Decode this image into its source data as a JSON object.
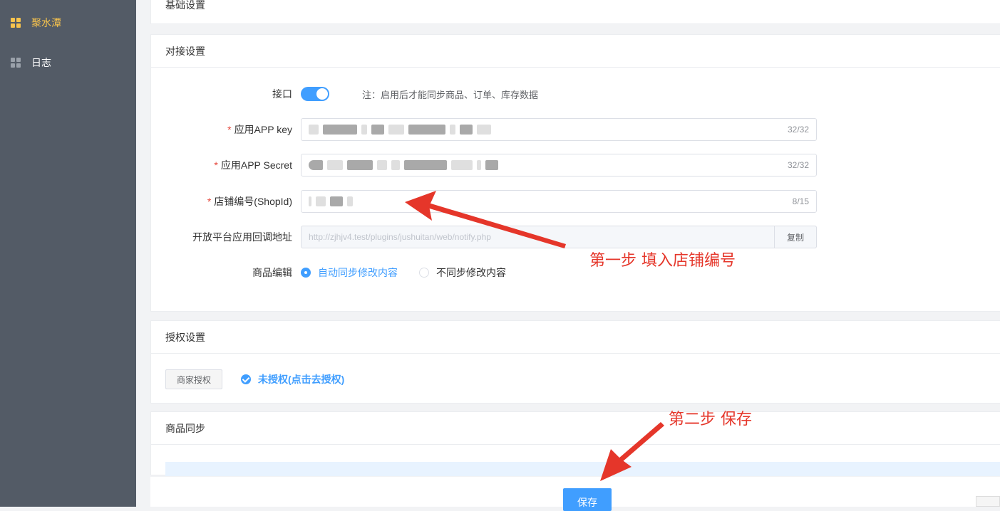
{
  "sidebar": {
    "items": [
      {
        "label": "聚水潭",
        "active": true
      },
      {
        "label": "日志",
        "active": false
      }
    ]
  },
  "sections": {
    "basic": {
      "title": "基础设置"
    },
    "integration": {
      "title": "对接设置",
      "interface_label": "接口",
      "interface_note": "注：启用后才能同步商品、订单、库存数据",
      "app_key_label": "应用APP key",
      "app_key_count": "32/32",
      "app_secret_label": "应用APP Secret",
      "app_secret_count": "32/32",
      "shop_id_label": "店铺编号(ShopId)",
      "shop_id_count": "8/15",
      "callback_label": "开放平台应用回调地址",
      "callback_value": "http://zjhjv4.test/plugins/jushuitan/web/notify.php",
      "copy_label": "复制",
      "goods_edit_label": "商品编辑",
      "goods_edit_options": [
        {
          "label": "自动同步修改内容",
          "selected": true
        },
        {
          "label": "不同步修改内容",
          "selected": false
        }
      ]
    },
    "auth": {
      "title": "授权设置",
      "merchant_auth_button": "商家授权",
      "auth_status": "未授权(点击去授权)"
    },
    "goods_sync": {
      "title": "商品同步"
    }
  },
  "footer": {
    "save_label": "保存"
  },
  "annotations": {
    "step1": "第一步 填入店铺编号",
    "step2": "第二步 保存"
  },
  "colors": {
    "sidebar_bg": "#535b66",
    "active": "#f7c34d",
    "primary": "#409eff",
    "annotation": "#e5362a"
  }
}
